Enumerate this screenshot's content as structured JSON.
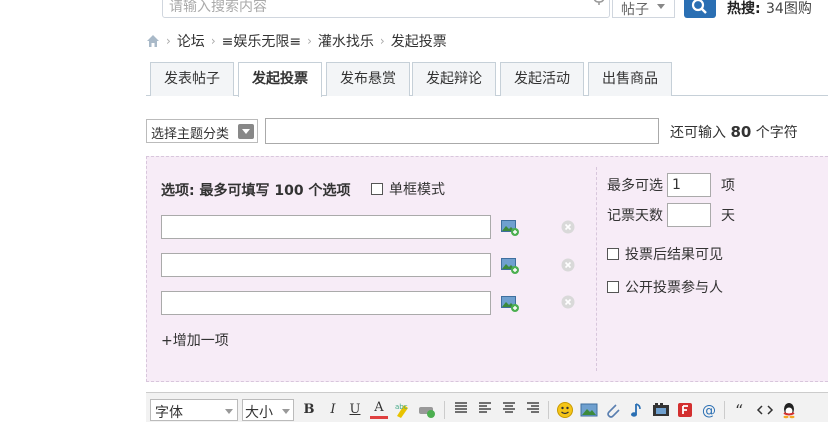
{
  "search": {
    "placeholder": "请输入搜索内容",
    "type_label": "帖子",
    "hot_label": "热搜:",
    "hot_text": "34图购"
  },
  "breadcrumb": {
    "items": [
      "论坛",
      "≡娱乐无限≡",
      "灌水找乐",
      "发起投票"
    ]
  },
  "tabs": [
    {
      "label": "发表帖子"
    },
    {
      "label": "发起投票"
    },
    {
      "label": "发布悬赏"
    },
    {
      "label": "发起辩论"
    },
    {
      "label": "发起活动"
    },
    {
      "label": "出售商品"
    }
  ],
  "subject": {
    "category_label": "选择主题分类",
    "hint_prefix": "还可输入",
    "hint_count": "80",
    "hint_suffix": "个字符"
  },
  "poll": {
    "options_title": "选项: 最多可填写 100 个选项",
    "single_mode_label": "单框模式",
    "add_item_label": "+增加一项",
    "max_choice_label": "最多可选",
    "max_choice_value": "1",
    "max_choice_unit": "项",
    "days_label": "记票天数",
    "days_value": "",
    "days_unit": "天",
    "visible_after_vote_label": "投票后结果可见",
    "public_voters_label": "公开投票参与人"
  },
  "editor": {
    "font_label": "字体",
    "size_label": "大小",
    "bold": "B",
    "italic": "I",
    "underline": "U",
    "font_color": "A"
  }
}
